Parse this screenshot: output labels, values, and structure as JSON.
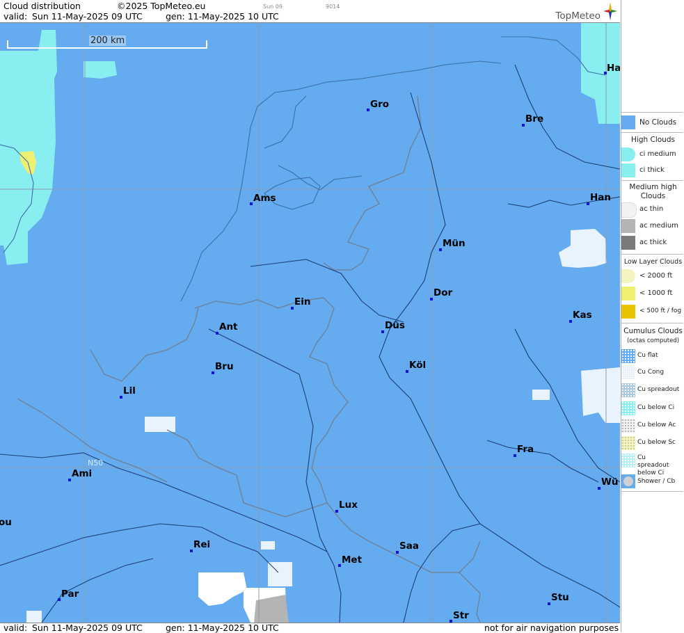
{
  "header": {
    "title": "Cloud distribution",
    "copyright": "©2025 TopMeteo.eu",
    "run_code": "Sun 09",
    "id_code": "9014",
    "valid_label": "valid:",
    "valid_time": "Sun  11-May-2025  09 UTC",
    "gen_time": "gen: 11-May-2025 10 UTC",
    "brand": "TopMeteo"
  },
  "map": {
    "scale_label": "200 km",
    "lat_label": "N50",
    "cities": [
      {
        "name": "Ha"
      },
      {
        "name": "Gro"
      },
      {
        "name": "Bre"
      },
      {
        "name": "Ams"
      },
      {
        "name": "Han"
      },
      {
        "name": "Mün"
      },
      {
        "name": "Dor"
      },
      {
        "name": "Ein"
      },
      {
        "name": "Ant"
      },
      {
        "name": "Düs"
      },
      {
        "name": "Kas"
      },
      {
        "name": "Köl"
      },
      {
        "name": "Bru"
      },
      {
        "name": "Lil"
      },
      {
        "name": "Fra"
      },
      {
        "name": "Ami"
      },
      {
        "name": "Wü"
      },
      {
        "name": "Lux"
      },
      {
        "name": "ou"
      },
      {
        "name": "Rei"
      },
      {
        "name": "Saa"
      },
      {
        "name": "Met"
      },
      {
        "name": "Par"
      },
      {
        "name": "Stu"
      },
      {
        "name": "Str"
      }
    ]
  },
  "footer": {
    "valid_label": "valid:",
    "valid_time": "Sun  11-May-2025  09 UTC",
    "gen_time": "gen: 11-May-2025 10 UTC",
    "disclaimer": "not for air navigation purposes"
  },
  "legend": {
    "no_clouds": "No Clouds",
    "high_head": "High Clouds",
    "ci_medium": "ci medium",
    "ci_thick": "ci thick",
    "medium_head": "Medium high Clouds",
    "ac_thin": "ac thin",
    "ac_medium": "ac medium",
    "ac_thick": "ac thick",
    "low_head": "Low Layer Clouds",
    "low_2000": "< 2000 ft",
    "low_1000": "< 1000 ft",
    "low_500": "< 500 ft / fog",
    "cu_head": "Cumulus Clouds",
    "cu_sub": "(octas computed)",
    "cu_flat": "Cu flat",
    "cu_cong": "Cu Cong",
    "cu_spread": "Cu spreadout",
    "cu_below_ci": "Cu below Ci",
    "cu_below_ac": "Cu below Ac",
    "cu_below_sc": "Cu below Sc",
    "cu_spread_below_ci": "Cu spreadout below Ci",
    "shower": "Shower / Cb",
    "colors": {
      "no_clouds": "#64acef",
      "ci": "#88eef0",
      "ac_thin": "#f2f2f2",
      "ac_medium": "#b4b4b4",
      "ac_thick": "#7a7a7a",
      "low_2000": "#f4f4c0",
      "low_1000": "#f0f070",
      "low_500": "#e8c400"
    }
  }
}
